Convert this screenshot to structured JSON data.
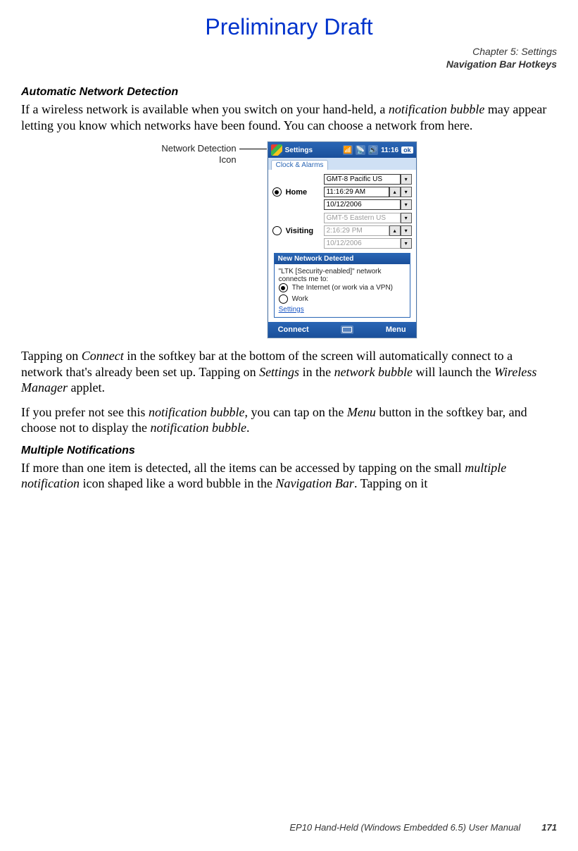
{
  "draft_title": "Preliminary Draft",
  "header": {
    "chapter_line": "Chapter 5: Settings",
    "section_line": "Navigation Bar Hotkeys"
  },
  "section1": {
    "heading": "Automatic Network Detection",
    "para1_pre": " If a wireless network is available when you switch on your hand-held, a ",
    "para1_em": "notification bubble",
    "para1_post": " may appear letting you know which networks have been found. You can choose a network from here."
  },
  "figure": {
    "label_line1": "Network Detection",
    "label_line2": "Icon"
  },
  "device": {
    "title": "Settings",
    "time": "11:16",
    "ok": "ok",
    "tab": "Clock & Alarms",
    "home_label": "Home",
    "visiting_label": "Visiting",
    "home_tz": "GMT-8 Pacific US",
    "home_time": "11:16:29 AM",
    "home_date": "10/12/2006",
    "visit_tz": "GMT-5 Eastern US",
    "visit_time": "2:16:29 PM",
    "visit_date": "10/12/2006",
    "popup_title": "New Network Detected",
    "popup_text": "\"LTK [Security-enabled]\" network connects me to:",
    "popup_opt1": "The Internet (or work via a VPN)",
    "popup_opt2": "Work",
    "popup_settings": "Settings",
    "soft_left": "Connect",
    "soft_right": "Menu"
  },
  "after_fig": {
    "p1_a": "Tapping on ",
    "p1_em1": "Connect",
    "p1_b": " in the softkey bar at the bottom of the screen will automatically connect to a network that's already been set up. Tapping on ",
    "p1_em2": "Settings",
    "p1_c": " in the ",
    "p1_em3": "network bubble",
    "p1_d": " will launch the ",
    "p1_em4": "Wireless Manager",
    "p1_e": " applet.",
    "p2_a": "If you prefer not see this ",
    "p2_em1": "notification bubble",
    "p2_b": ", you can tap on the ",
    "p2_em2": "Menu",
    "p2_c": " button in the softkey bar, and choose not to display the ",
    "p2_em3": "notification bubble",
    "p2_d": "."
  },
  "section2": {
    "heading": "Multiple Notifications",
    "p_a": "If more than one item is detected, all the items can be accessed by tapping on the small ",
    "p_em1": "multiple notification",
    "p_b": " icon shaped like a word bubble in the ",
    "p_em2": "Navigation Bar",
    "p_c": ". Tapping on it"
  },
  "footer": {
    "manual": "EP10 Hand-Held (Windows Embedded 6.5) User Manual",
    "page": "171"
  }
}
